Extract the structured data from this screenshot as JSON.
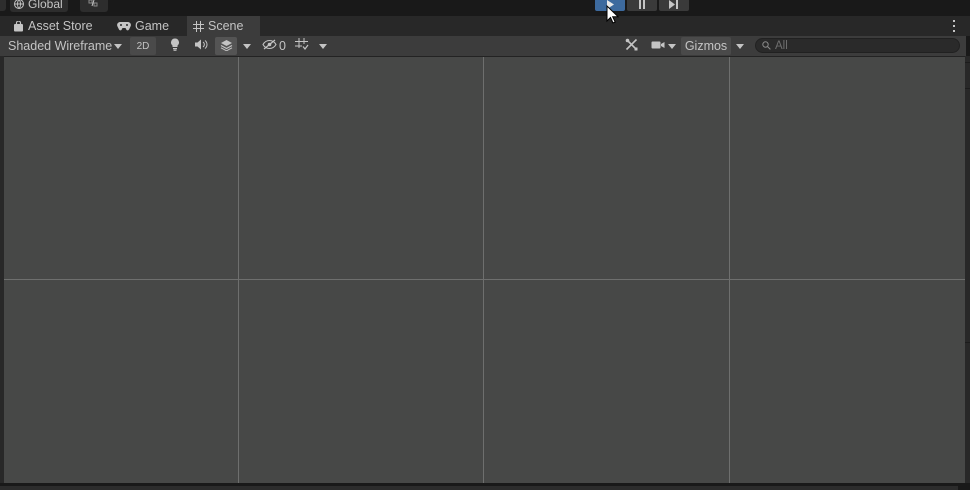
{
  "top_toolbar": {
    "pivot_rotation_label": "Global",
    "play_button": "play",
    "pause_button": "pause",
    "step_button": "step"
  },
  "tabs": [
    {
      "label": "Asset Store",
      "icon": "bag-icon",
      "active": false
    },
    {
      "label": "Game",
      "icon": "gamepad-icon",
      "active": false
    },
    {
      "label": "Scene",
      "icon": "grid-hash-icon",
      "active": true
    }
  ],
  "scene_toolbar": {
    "draw_mode": "Shaded Wireframe",
    "mode_2d": "2D",
    "hidden_count": "0",
    "gizmos_label": "Gizmos",
    "search_placeholder": "All"
  },
  "colors": {
    "viewport_bg": "#474847",
    "grid_line": "#6e6f6e",
    "play_active": "#3d6a9e"
  }
}
